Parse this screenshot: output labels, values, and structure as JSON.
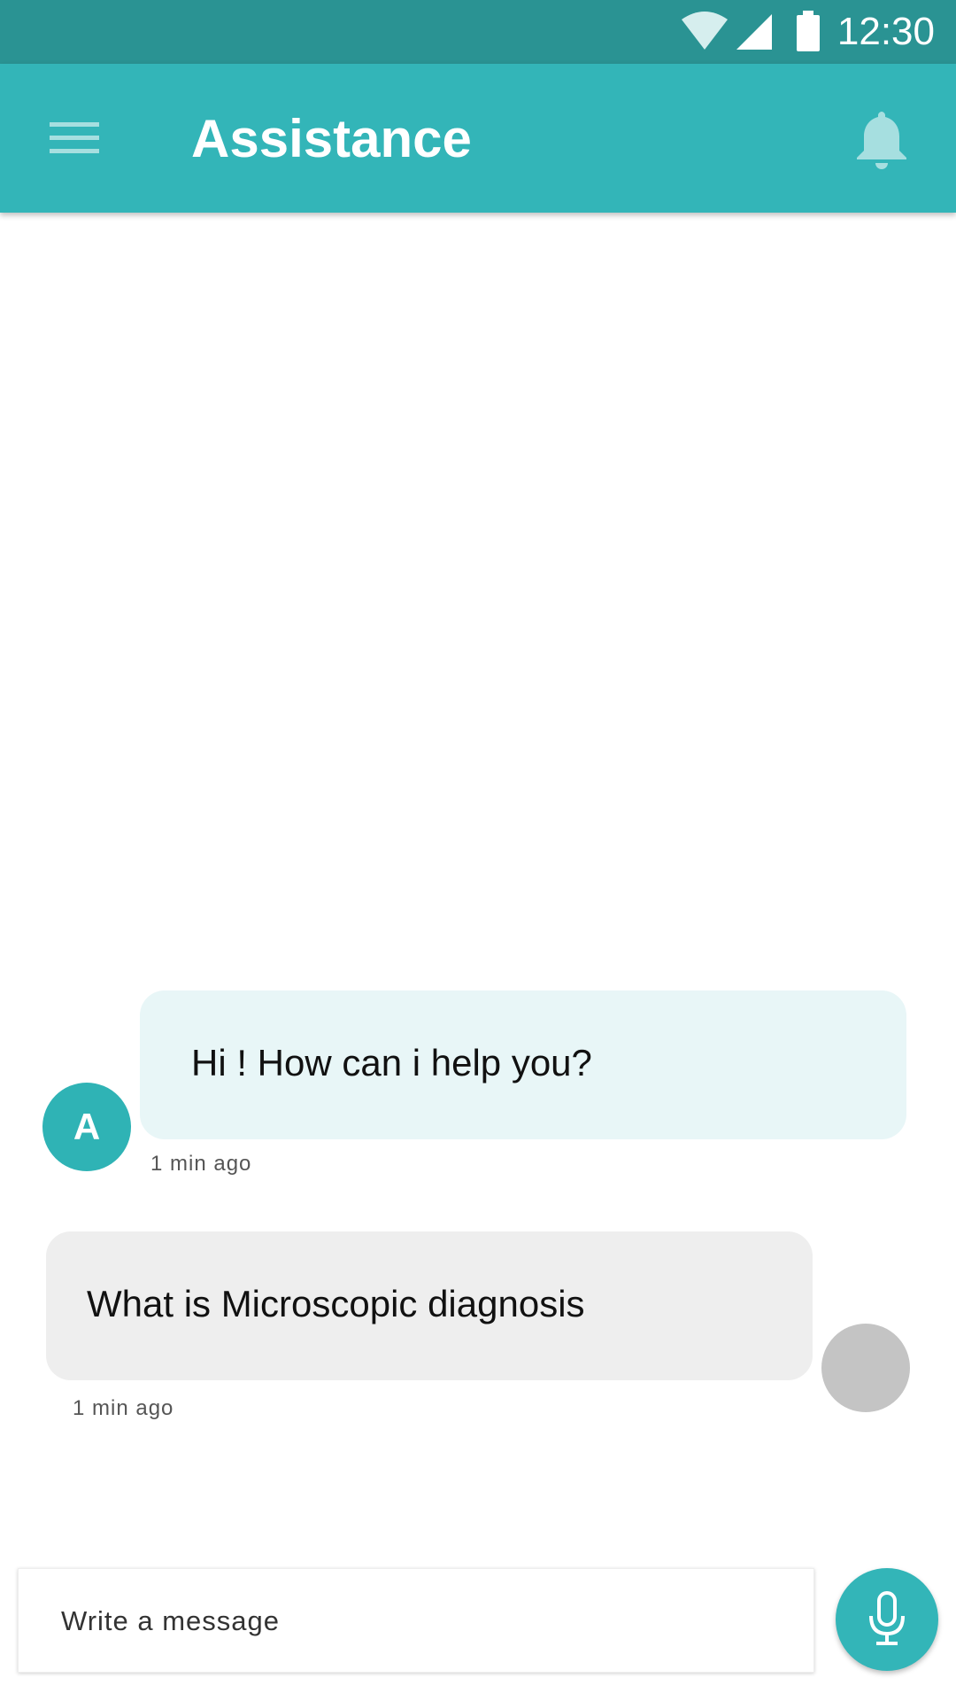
{
  "status_bar": {
    "time": "12:30",
    "icons": [
      "wifi-icon",
      "signal-icon",
      "battery-icon"
    ]
  },
  "app_bar": {
    "title": "Assistance",
    "left_icon": "menu-icon",
    "right_icon": "bell-icon",
    "color": "#33b5b8"
  },
  "messages": [
    {
      "sender": "assistant",
      "avatar_letter": "A",
      "text": "Hi ! How can i help you?",
      "time": "1 min ago",
      "bubble_color": "#e8f6f7"
    },
    {
      "sender": "user",
      "text": "What is Microscopic diagnosis",
      "time": "1 min ago",
      "bubble_color": "#eeeeee"
    }
  ],
  "composer": {
    "placeholder": "Write a message",
    "value": "",
    "mic_icon": "mic-icon"
  },
  "colors": {
    "status_bar": "#2a9393",
    "accent": "#33b5b8",
    "bot_avatar": "#2fb3b5",
    "user_avatar": "#c4c4c4"
  }
}
